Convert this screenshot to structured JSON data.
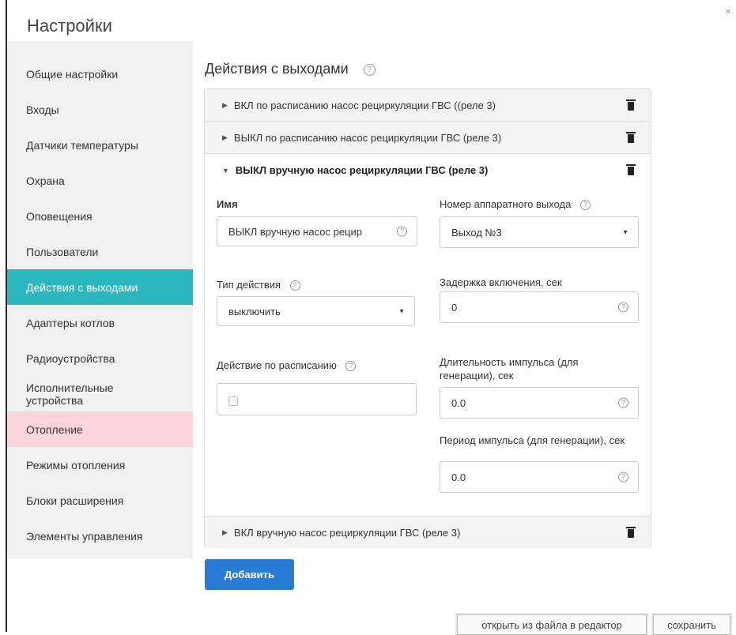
{
  "window": {
    "title": "Настройки",
    "close_glyph": "×"
  },
  "sidebar": {
    "items": [
      {
        "label": "Общие настройки"
      },
      {
        "label": "Входы"
      },
      {
        "label": "Датчики температуры"
      },
      {
        "label": "Охрана"
      },
      {
        "label": "Оповещения"
      },
      {
        "label": "Пользователи"
      },
      {
        "label": "Действия с выходами"
      },
      {
        "label": "Адаптеры котлов"
      },
      {
        "label": "Радиоустройства"
      },
      {
        "label": "Исполнительные устройства"
      },
      {
        "label": "Отопление"
      },
      {
        "label": "Режимы отопления"
      },
      {
        "label": "Блоки расширения"
      },
      {
        "label": "Элементы управления"
      }
    ],
    "active_index": 6,
    "active_color": "#2ab7bd",
    "highlight_index": 10,
    "highlight_color": "#fdd4dc"
  },
  "main": {
    "section_title": "Действия с выходами",
    "help_glyph": "?",
    "actions": [
      {
        "title": "ВКЛ по расписанию насос рециркуляции ГВС ((реле 3)",
        "expanded": false
      },
      {
        "title": "ВЫКЛ по расписанию насос рециркуляции ГВС (реле 3)",
        "expanded": false
      },
      {
        "title": "ВЫКЛ вручную насос рециркуляции ГВС (реле 3)",
        "expanded": true
      },
      {
        "title": "ВКЛ вручную насос рециркуляции ГВС (реле 3)",
        "expanded": false
      }
    ],
    "form": {
      "name_label": "Имя",
      "name_value": "ВЫКЛ вручную насос рецир",
      "output_label": "Номер аппаратного выхода",
      "output_value": "Выход №3",
      "action_type_label": "Тип действия",
      "action_type_value": "выключить",
      "delay_label": "Задержка включения, сек",
      "delay_value": "0",
      "schedule_label": "Действие по расписанию",
      "schedule_checked": false,
      "pulse_duration_label": "Длительность импульса (для генерации), сек",
      "pulse_duration_value": "0.0",
      "pulse_period_label": "Период импульса (для генерации), сек",
      "pulse_period_value": "0.0"
    },
    "add_button_label": "Добавить",
    "add_button_color": "#2a7bd6"
  },
  "footer": {
    "open_in_editor_label": "открыть из файла в редактор",
    "save_label": "сохранить"
  }
}
